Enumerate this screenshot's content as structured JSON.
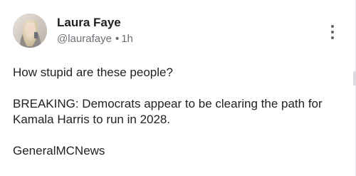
{
  "post": {
    "author": {
      "name": "Laura Faye",
      "handle": "@laurafaye",
      "separator": "•",
      "time": "1h",
      "avatar_icon": "profile-photo"
    },
    "menu_icon": "more-vertical-icon",
    "body": {
      "line1": "How stupid are these people?",
      "line2": "BREAKING: Democrats appear to be clearing the path for Kamala Harris to run in 2028.",
      "line3": "GeneralMCNews"
    }
  },
  "colors": {
    "name": "#1f1f1f",
    "meta": "#6b6f76",
    "body_text": "#222222",
    "background": "#ffffff"
  }
}
